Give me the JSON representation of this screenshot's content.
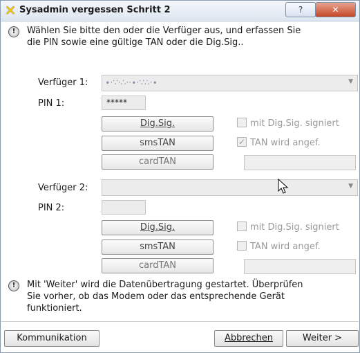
{
  "window": {
    "title": "Sysadmin vergessen Schritt 2",
    "help": "?",
    "close": "✕"
  },
  "intro": {
    "line1": "Wählen Sie bitte den oder die Verfüger aus, und erfassen Sie",
    "line2": "die PIN sowie eine gültige TAN oder die Dig.Sig.."
  },
  "verfueger1": {
    "label": "Verfüger 1:",
    "value_masked": "∙·∵·∴··∙·∵∴·∙",
    "pin_label": "PIN 1:",
    "pin_value": "*****",
    "btn_digsig": "Dig.Sig.",
    "btn_smstan": "smsTAN",
    "btn_cardtan": "cardTAN",
    "chk_digsig": "mit Dig.Sig. signiert",
    "chk_tan": "TAN wird angef.",
    "chk_digsig_checked": false,
    "chk_tan_checked": true
  },
  "verfueger2": {
    "label": "Verfüger 2:",
    "value": "",
    "pin_label": "PIN 2:",
    "pin_value": "",
    "btn_digsig": "Dig.Sig.",
    "btn_smstan": "smsTAN",
    "btn_cardtan": "cardTAN",
    "chk_digsig": "mit Dig.Sig. signiert",
    "chk_tan": "TAN wird angef.",
    "chk_digsig_checked": false,
    "chk_tan_checked": false
  },
  "outro": {
    "line1": "Mit 'Weiter' wird die Datenübertragung gestartet. Überprüfen",
    "line2": "Sie vorher, ob das Modem oder das entsprechende Gerät",
    "line3": "funktioniert."
  },
  "footer": {
    "kommunikation": "Kommunikation",
    "abbrechen": "Abbrechen",
    "weiter": "Weiter >"
  }
}
